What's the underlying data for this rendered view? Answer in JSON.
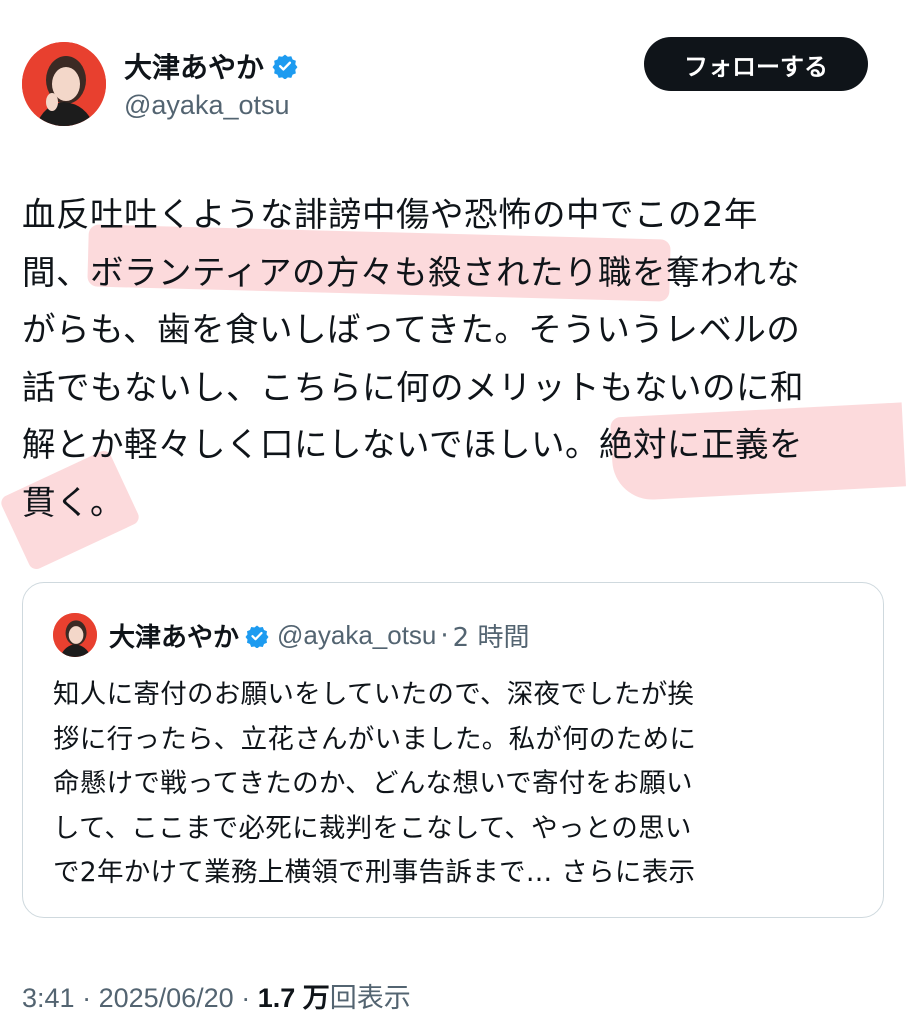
{
  "header": {
    "name": "大津あやか",
    "handle": "@ayaka_otsu",
    "follow_label": "フォローする",
    "verified_icon": "verified-badge-icon"
  },
  "tweet": {
    "lines": [
      "血反吐吐くような誹謗中傷や恐怖の中でこの2年",
      "間、ボランティアの方々も殺されたり職を奪われな",
      "がらも、歯を食いしばってきた。そういうレベルの",
      "話でもないし、こちらに何のメリットもないのに和",
      "解とか軽々しく口にしないでほしい。絶対に正義を",
      "貫く。"
    ]
  },
  "quote": {
    "name": "大津あやか",
    "handle": "@ayaka_otsu",
    "separator": "·",
    "time": "2 時間",
    "lines": [
      "知人に寄付のお願いをしていたので、深夜でしたが挨",
      "拶に行ったら、立花さんがいました。私が何のために",
      "命懸けで戦ってきたのか、どんな想いで寄付をお願い",
      "して、ここまで必死に裁判をこなして、やっとの思い",
      "で2年かけて業務上横領で刑事告訴まで…"
    ],
    "show_more": "さらに表示"
  },
  "footer": {
    "time": "3:41",
    "sep1": " · ",
    "date": "2025/06/20",
    "sep2": " · ",
    "views_count": "1.7 万",
    "views_label": "回表示"
  },
  "colors": {
    "highlight": "#fbd3d6",
    "verified": "#1d9bf0",
    "follow_bg": "#0f1419",
    "muted_text": "#536471"
  }
}
